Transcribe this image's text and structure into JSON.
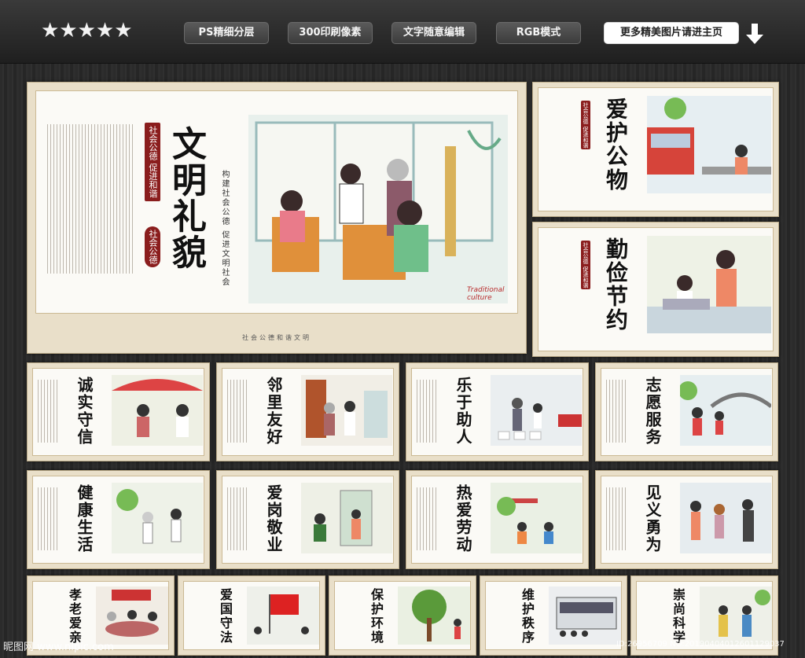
{
  "stars": "★★★★★",
  "badges": [
    "PS精细分层",
    "300印刷像素",
    "文字随意编辑",
    "RGB模式"
  ],
  "more_btn": "更多精美图片请进主页",
  "main": {
    "title": "文明礼貌",
    "seal_red1": "社会公德 促进和谐",
    "seal_red2": "社会公德",
    "subtitle": "构建社会公德 促进文明社会",
    "en_label": "Traditional culture",
    "footer": "社会公德和谐文明"
  },
  "side_panels": [
    {
      "title": "爱护公物",
      "tag": "社会公德 促进和谐"
    },
    {
      "title": "勤俭节约",
      "tag": "社会公德 促进和谐"
    }
  ],
  "grid_row1": [
    "诚实守信",
    "邻里友好",
    "乐于助人",
    "志愿服务"
  ],
  "grid_row2": [
    "健康生活",
    "爱岗敬业",
    "热爱劳动",
    "见义勇为"
  ],
  "grid_row3": [
    "孝老爱亲",
    "爱国守法",
    "保护环境",
    "维护秩序",
    "崇尚科学"
  ],
  "watermark_left": "昵图网 www.nipic.com",
  "watermark_right": "ID:26956709 NO:20190404012601129037"
}
